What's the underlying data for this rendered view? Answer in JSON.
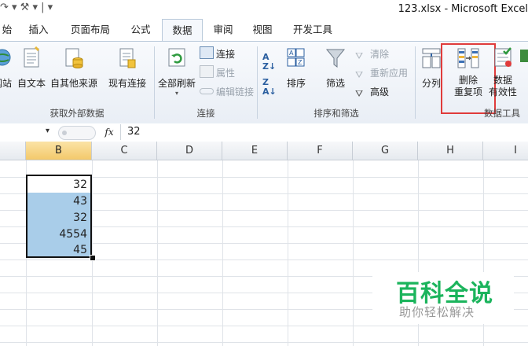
{
  "titlebar": {
    "qat_glyphs": "↷ ▾ ⚒ ▾ | ▾",
    "title": "123.xlsx  -  Microsoft Excel"
  },
  "tabs": [
    {
      "label": "始",
      "active": false
    },
    {
      "label": "插入",
      "active": false
    },
    {
      "label": "页面布局",
      "active": false
    },
    {
      "label": "公式",
      "active": false
    },
    {
      "label": "数据",
      "active": true
    },
    {
      "label": "审阅",
      "active": false
    },
    {
      "label": "视图",
      "active": false
    },
    {
      "label": "开发工具",
      "active": false
    }
  ],
  "ribbon": {
    "get_external": {
      "web_label": "网站",
      "text_label": "自文本",
      "other_label": "自其他来源",
      "existing_label": "现有连接",
      "group_label": "获取外部数据"
    },
    "connections": {
      "refresh_label": "全部刷新",
      "connect_label": "连接",
      "props_label": "属性",
      "editlinks_label": "编辑链接",
      "group_label": "连接"
    },
    "sortfilter": {
      "sort_label": "排序",
      "filter_label": "筛选",
      "clear_label": "清除",
      "reapply_label": "重新应用",
      "advanced_label": "高级",
      "group_label": "排序和筛选"
    },
    "datatools": {
      "split_label": "分列",
      "remove_dup_line1": "删除",
      "remove_dup_line2": "重复项",
      "validation_line1": "数据",
      "validation_line2": "有效性",
      "group_label": "数据工具"
    },
    "highlight_color": "#e03b3b"
  },
  "formulabar": {
    "fx_label": "fx",
    "formula_value": "32"
  },
  "grid": {
    "columns": [
      "B",
      "C",
      "D",
      "E",
      "F",
      "G",
      "H",
      "I"
    ],
    "selected_column": "B",
    "values": [
      "32",
      "43",
      "32",
      "4554",
      "45"
    ],
    "selection_color": "#a9cde9"
  },
  "watermark": {
    "main": "百科全说",
    "sub": "助你轻松解决"
  }
}
